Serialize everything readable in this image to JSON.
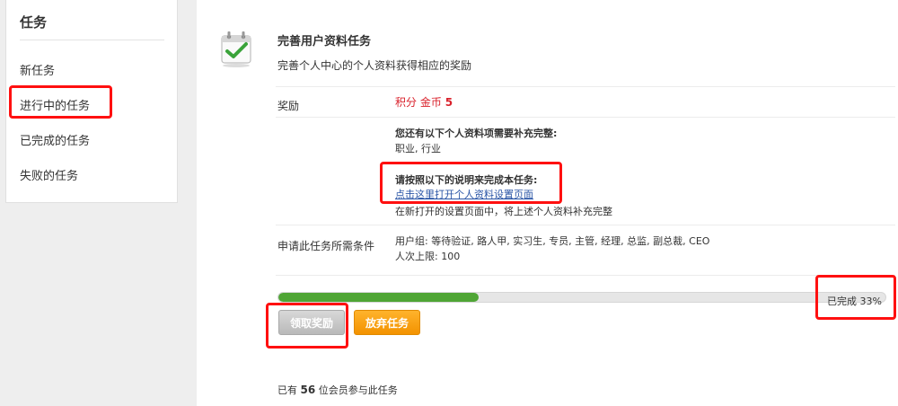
{
  "sidebar": {
    "title": "任务",
    "items": [
      {
        "label": "新任务"
      },
      {
        "label": "进行中的任务"
      },
      {
        "label": "已完成的任务"
      },
      {
        "label": "失败的任务"
      }
    ]
  },
  "task": {
    "title": "完善用户资料任务",
    "description": "完善个人中心的个人资料获得相应的奖励",
    "reward_label": "奖励",
    "reward_points": "积分",
    "reward_coin": "金币",
    "reward_amount": "5",
    "missing_heading": "您还有以下个人资料项需要补充完整:",
    "missing_fields": "职业, 行业",
    "instructions_heading": "请按照以下的说明来完成本任务:",
    "instructions_link": "点击这里打开个人资料设置页面",
    "instructions_note": "在新打开的设置页面中，将上述个人资料补充完整",
    "conditions_label": "申请此任务所需条件",
    "user_groups": "用户组: 等待验证, 路人甲, 实习生, 专员, 主管, 经理, 总监, 副总裁, CEO",
    "limit": "人次上限: 100",
    "progress_text": "已完成 33%",
    "progress_value": 0.33,
    "claim_button": "领取奖励",
    "abandon_button": "放弃任务",
    "participants_prefix": "已有",
    "participants_count": "56",
    "participants_suffix": "位会员参与此任务"
  },
  "colors": {
    "progress_fill": "#4fa535",
    "abandon_button": "#f7a00e",
    "highlight": "#ff1010",
    "reward_text": "#d9212b"
  }
}
